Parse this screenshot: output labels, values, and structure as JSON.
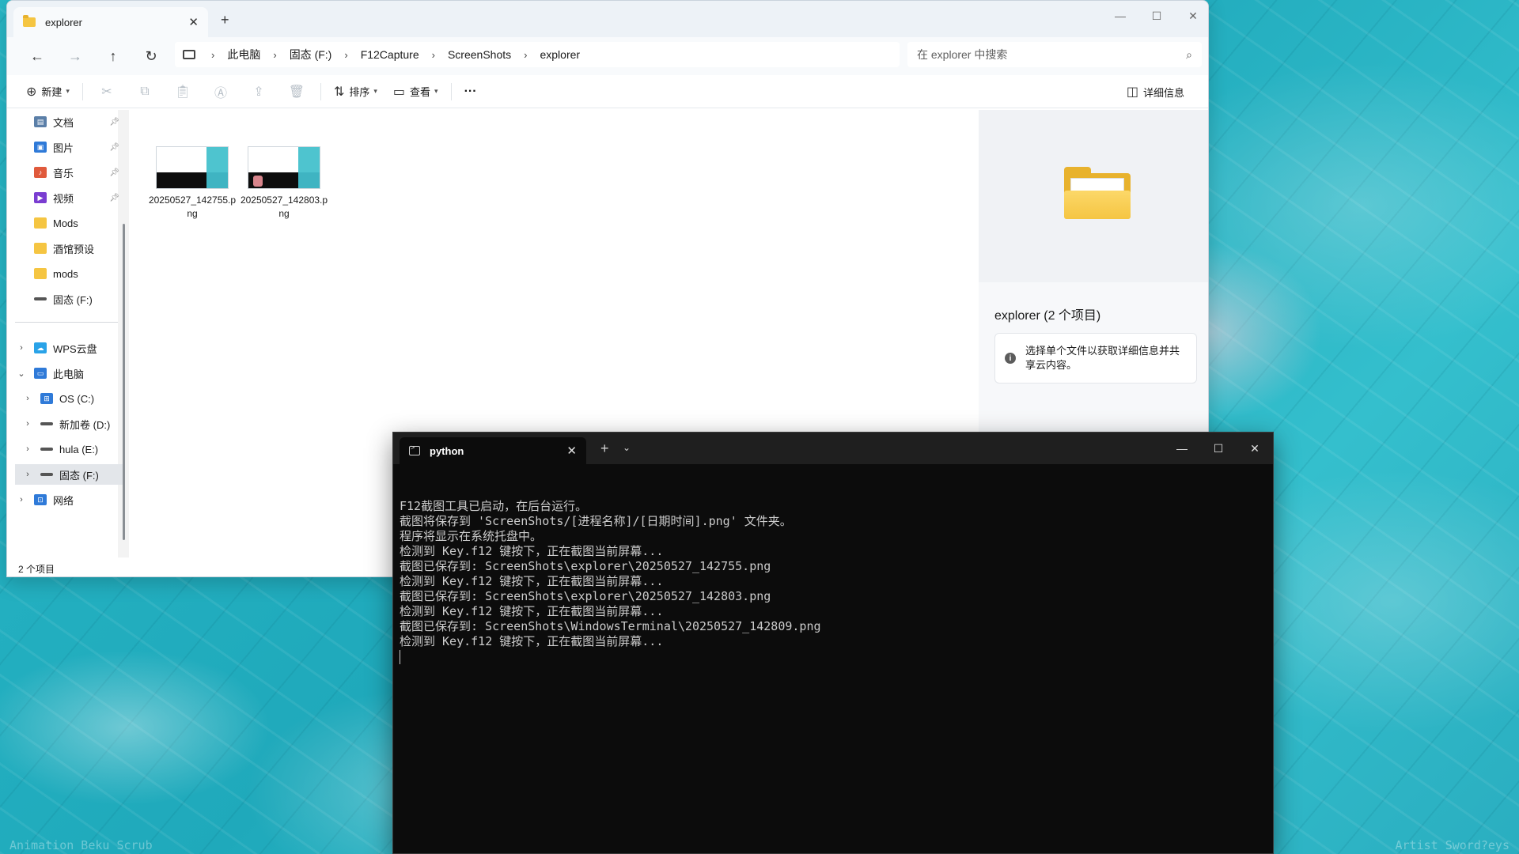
{
  "wallpaper": {
    "caption_left": "Animation  Beku Scrub",
    "caption_right": "Artist  Sword?eys"
  },
  "explorer": {
    "tab_title": "explorer",
    "breadcrumb": [
      "此电脑",
      "固态 (F:)",
      "F12Capture",
      "ScreenShots",
      "explorer"
    ],
    "search_placeholder": "在 explorer 中搜索",
    "commands": {
      "new_label": "新建",
      "sort_label": "排序",
      "view_label": "查看",
      "more_label": "···",
      "details_label": "详细信息"
    },
    "sidebar": [
      {
        "label": "文档",
        "icon": "document-icon",
        "color": "#5b7fa8",
        "pinned": true
      },
      {
        "label": "图片",
        "icon": "picture-icon",
        "color": "#2f7ad8",
        "pinned": true
      },
      {
        "label": "音乐",
        "icon": "music-icon",
        "color": "#e05a3c",
        "pinned": true
      },
      {
        "label": "视频",
        "icon": "video-icon",
        "color": "#7a3dd1",
        "pinned": true
      },
      {
        "label": "Mods",
        "icon": "folder-icon",
        "color": "#f5c542",
        "pinned": false
      },
      {
        "label": "酒馆预设",
        "icon": "folder-icon",
        "color": "#f5c542",
        "pinned": false
      },
      {
        "label": "mods",
        "icon": "folder-icon",
        "color": "#f5c542",
        "pinned": false
      },
      {
        "label": "固态 (F:)",
        "icon": "drive-icon",
        "color": "#555555",
        "pinned": false
      }
    ],
    "tree": [
      {
        "label": "WPS云盘",
        "icon": "cloud-icon",
        "color": "#2aa3e8",
        "expanded": false,
        "level": 0
      },
      {
        "label": "此电脑",
        "icon": "pc-icon",
        "color": "#2f7ad8",
        "expanded": true,
        "level": 0
      },
      {
        "label": "OS (C:)",
        "icon": "windows-drive-icon",
        "color": "#2f7ad8",
        "expanded": false,
        "level": 1
      },
      {
        "label": "新加卷 (D:)",
        "icon": "drive-icon",
        "color": "#555555",
        "expanded": false,
        "level": 1
      },
      {
        "label": "hula (E:)",
        "icon": "drive-icon",
        "color": "#555555",
        "expanded": false,
        "level": 1
      },
      {
        "label": "固态 (F:)",
        "icon": "drive-icon",
        "color": "#555555",
        "expanded": false,
        "level": 1,
        "selected": true
      },
      {
        "label": "网络",
        "icon": "network-icon",
        "color": "#2f7ad8",
        "expanded": false,
        "level": 0
      }
    ],
    "files": [
      {
        "name": "20250527_142755.png"
      },
      {
        "name": "20250527_142803.png"
      }
    ],
    "details": {
      "title": "explorer (2 个项目)",
      "message": "选择单个文件以获取详细信息并共享云内容。"
    },
    "status": "2 个项目"
  },
  "terminal": {
    "tab_title": "python",
    "lines": [
      "F12截图工具已启动，在后台运行。",
      "截图将保存到 'ScreenShots/[进程名称]/[日期时间].png' 文件夹。",
      "程序将显示在系统托盘中。",
      "检测到 Key.f12 键按下，正在截图当前屏幕...",
      "截图已保存到: ScreenShots\\explorer\\20250527_142755.png",
      "检测到 Key.f12 键按下，正在截图当前屏幕...",
      "截图已保存到: ScreenShots\\explorer\\20250527_142803.png",
      "检测到 Key.f12 键按下，正在截图当前屏幕...",
      "截图已保存到: ScreenShots\\WindowsTerminal\\20250527_142809.png",
      "检测到 Key.f12 键按下，正在截图当前屏幕..."
    ]
  }
}
